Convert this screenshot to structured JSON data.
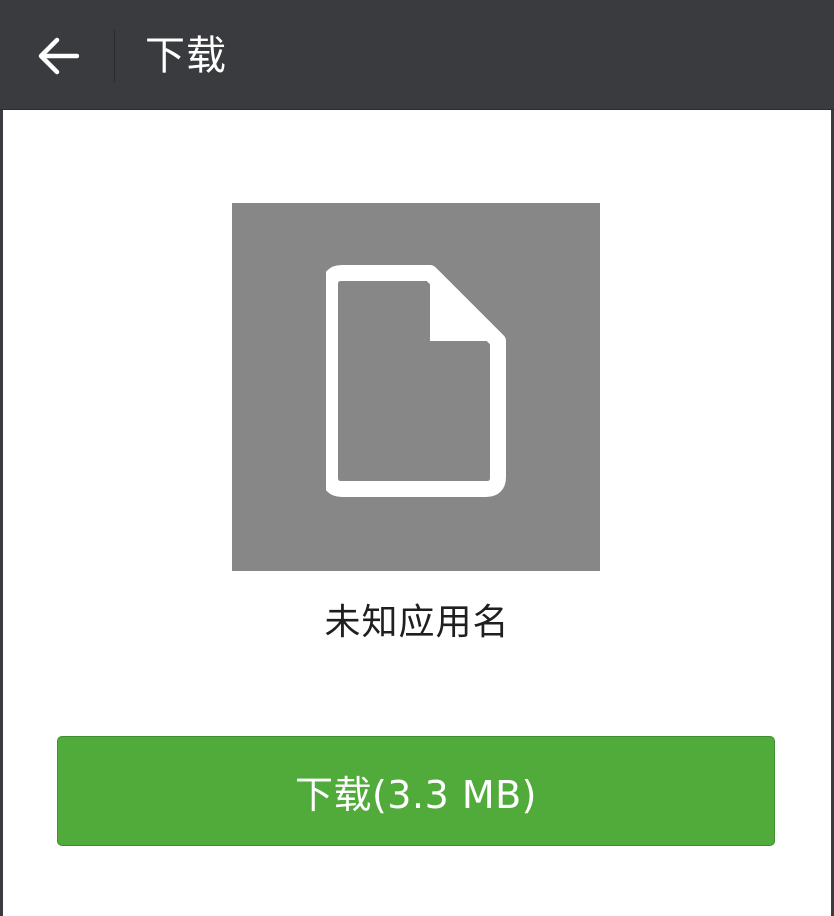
{
  "header": {
    "title": "下载",
    "back_icon": "arrow-left-icon"
  },
  "app": {
    "icon": "file-icon",
    "name": "未知应用名"
  },
  "download_button": {
    "label": "下载(3.3 MB)"
  },
  "colors": {
    "header_bg": "#3a3b3f",
    "icon_bg": "#878787",
    "button_bg": "#50ab3b",
    "text_dark": "#1f1f1f"
  }
}
